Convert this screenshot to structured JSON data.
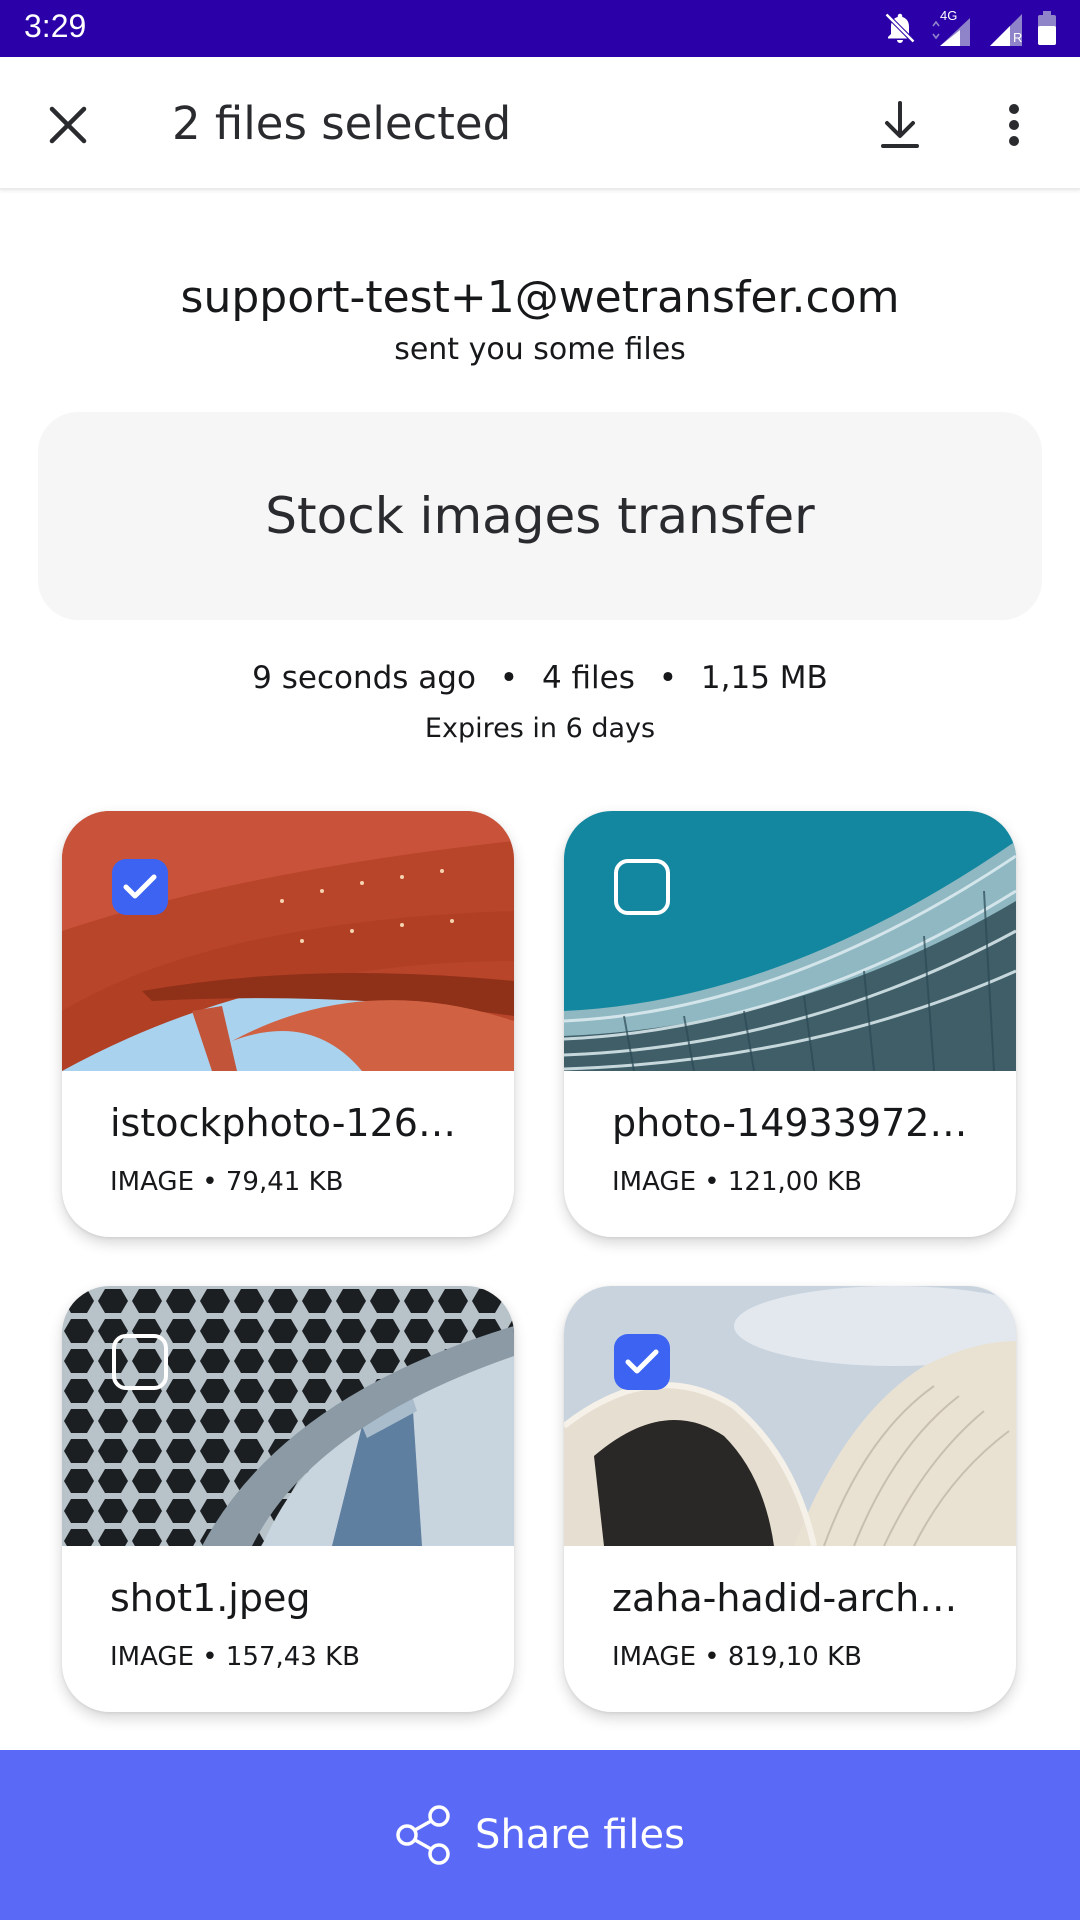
{
  "status_bar": {
    "time": "3:29",
    "network_label": "4G",
    "roaming_label": "R",
    "icons": [
      "bell-off-icon",
      "signal-icon",
      "signal-roaming-icon",
      "battery-icon"
    ]
  },
  "app_bar": {
    "title": "2 files selected",
    "icons": [
      "close-icon",
      "download-icon",
      "more-vert-icon"
    ]
  },
  "transfer": {
    "sender": "support-test+1@wetransfer.com",
    "sender_subtitle": "sent you some files",
    "title": "Stock images transfer",
    "time_ago": "9 seconds ago",
    "file_count": "4 files",
    "total_size": "1,15 MB",
    "separator": "•",
    "expires": "Expires in 6 days"
  },
  "files": [
    {
      "name": "istockphoto-126…",
      "meta": "IMAGE • 79,41 KB",
      "selected": true
    },
    {
      "name": "photo-14933972…",
      "meta": "IMAGE • 121,00 KB",
      "selected": false
    },
    {
      "name": "shot1.jpeg",
      "meta": "IMAGE • 157,43 KB",
      "selected": false
    },
    {
      "name": "zaha-hadid-arch…",
      "meta": "IMAGE • 819,10 KB",
      "selected": true
    }
  ],
  "share": {
    "label": "Share files",
    "icon": "share-icon"
  },
  "colors": {
    "status_bar": "#2b00a8",
    "accent": "#3d63f2",
    "share_bar": "#5a6af6"
  }
}
